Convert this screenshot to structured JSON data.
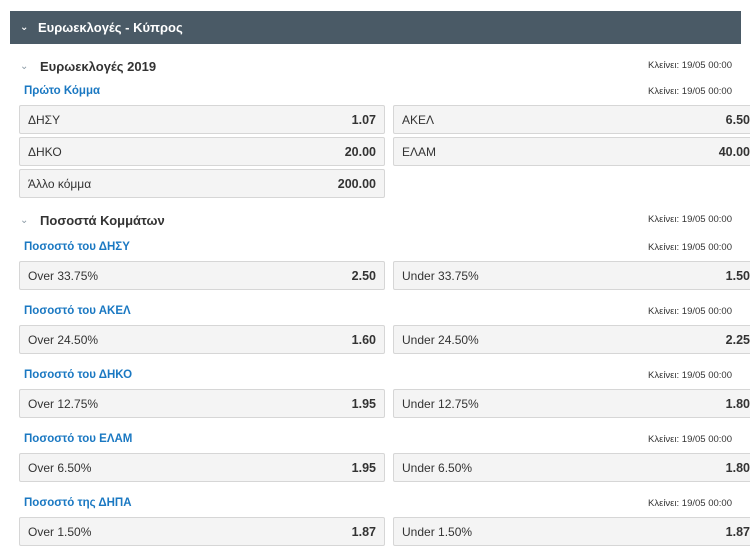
{
  "header": {
    "title": "Ευρωεκλογές - Κύπρος"
  },
  "sections": [
    {
      "title": "Ευρωεκλογές 2019",
      "closes": "Κλείνει: 19/05 00:00",
      "markets": [
        {
          "title": "Πρώτο Κόμμα",
          "closes": "Κλείνει: 19/05 00:00",
          "odds": [
            {
              "label": "ΔΗΣΥ",
              "value": "1.07"
            },
            {
              "label": "ΑΚΕΛ",
              "value": "6.50"
            },
            {
              "label": "ΔΗΚΟ",
              "value": "20.00"
            },
            {
              "label": "ΕΛΑΜ",
              "value": "40.00"
            },
            {
              "label": "Άλλο κόμμα",
              "value": "200.00"
            }
          ]
        }
      ]
    },
    {
      "title": "Ποσοστά Κομμάτων",
      "closes": "Κλείνει: 19/05 00:00",
      "markets": [
        {
          "title": "Ποσοστό του ΔΗΣΥ",
          "closes": "Κλείνει: 19/05 00:00",
          "odds": [
            {
              "label": "Over 33.75%",
              "value": "2.50"
            },
            {
              "label": "Under 33.75%",
              "value": "1.50"
            }
          ]
        },
        {
          "title": "Ποσοστό του ΑΚΕΛ",
          "closes": "Κλείνει: 19/05 00:00",
          "odds": [
            {
              "label": "Over 24.50%",
              "value": "1.60"
            },
            {
              "label": "Under 24.50%",
              "value": "2.25"
            }
          ]
        },
        {
          "title": "Ποσοστό του ΔΗΚΟ",
          "closes": "Κλείνει: 19/05 00:00",
          "odds": [
            {
              "label": "Over 12.75%",
              "value": "1.95"
            },
            {
              "label": "Under 12.75%",
              "value": "1.80"
            }
          ]
        },
        {
          "title": "Ποσοστό του ΕΛΑΜ",
          "closes": "Κλείνει: 19/05 00:00",
          "odds": [
            {
              "label": "Over 6.50%",
              "value": "1.95"
            },
            {
              "label": "Under 6.50%",
              "value": "1.80"
            }
          ]
        },
        {
          "title": "Ποσοστό της ΔΗΠΑ",
          "closes": "Κλείνει: 19/05 00:00",
          "odds": [
            {
              "label": "Over 1.50%",
              "value": "1.87"
            },
            {
              "label": "Under 1.50%",
              "value": "1.87"
            }
          ]
        }
      ]
    }
  ]
}
